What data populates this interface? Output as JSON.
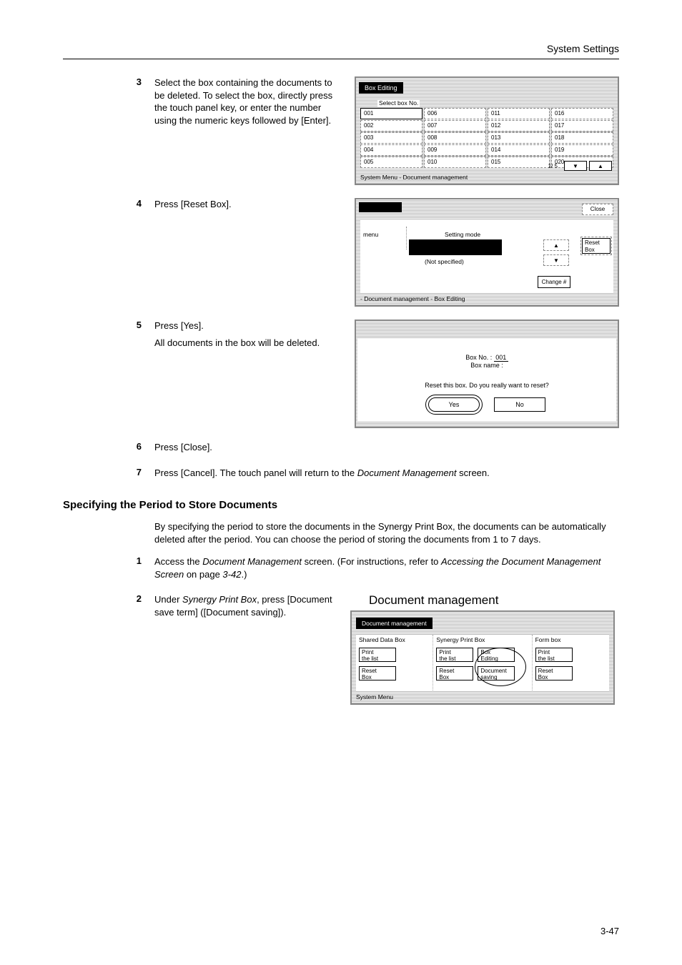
{
  "header": {
    "title": "System Settings"
  },
  "steps": {
    "s3": {
      "num": "3",
      "text": "Select the box containing the documents to be deleted. To select the box, directly press the touch panel key, or enter the number using the numeric keys followed by [Enter]."
    },
    "s4": {
      "num": "4",
      "text": "Press [Reset Box]."
    },
    "s5": {
      "num": "5",
      "line1": "Press [Yes].",
      "line2": "All documents in the box will be deleted."
    },
    "s6": {
      "num": "6",
      "text": "Press [Close]."
    },
    "s7": {
      "num": "7",
      "pre": "Press [Cancel]. The touch panel will return to the ",
      "italic": "Document Management",
      "post": " screen."
    }
  },
  "section": {
    "title": "Specifying the Period to Store Documents",
    "para": "By specifying the period to store the documents in the Synergy Print Box, the documents can be automatically deleted after the period. You can choose the period of storing the documents from 1 to 7 days."
  },
  "steps2": {
    "s1": {
      "num": "1",
      "pre": "Access the ",
      "it1": "Document Management",
      "mid": " screen. (For instructions, refer to ",
      "it2": "Accessing the Document Management Screen",
      "mid2": " on page ",
      "it3": "3-42",
      "post": ".)"
    },
    "s2": {
      "num": "2",
      "pre": "Under ",
      "it1": "Synergy Print Box",
      "post": ", press [Document save term] ([Document saving])."
    }
  },
  "screen1": {
    "tab": "Box Editing",
    "subtitle": "Select box No.",
    "cells": [
      [
        "001",
        "002",
        "003",
        "004",
        "005"
      ],
      [
        "006",
        "007",
        "008",
        "009",
        "010"
      ],
      [
        "011",
        "012",
        "013",
        "014",
        "015"
      ],
      [
        "016",
        "017",
        "018",
        "019",
        "020"
      ]
    ],
    "pager": "1/  5",
    "up": "▼",
    "down": "▲",
    "footer": "System Menu     -  Document management"
  },
  "screen2": {
    "close": "Close",
    "menu": "menu",
    "setmode": "Setting mode",
    "notspec": "(Not specified)",
    "up": "▲",
    "down": "▼",
    "change": "Change #",
    "reset": "Reset\nBox",
    "footer": "-  Document management    -  Box Editing"
  },
  "screen3": {
    "boxno_label": "Box No. : ",
    "boxno_value": "001",
    "boxname": "Box name :",
    "question": "Reset this box. Do you really want to reset?",
    "yes": "Yes",
    "no": "No"
  },
  "screen4": {
    "title_big": "Document management",
    "tab": "Document management",
    "shared": "Shared Data Box",
    "synergy": "Synergy Print Box",
    "form": "Form box",
    "print_list": "Print\nthe list",
    "reset_box": "Reset\nBox",
    "box_edit": "Box\nEditing",
    "doc_save": "Document\nsaving",
    "footer": "System Menu"
  },
  "page_number": "3-47"
}
